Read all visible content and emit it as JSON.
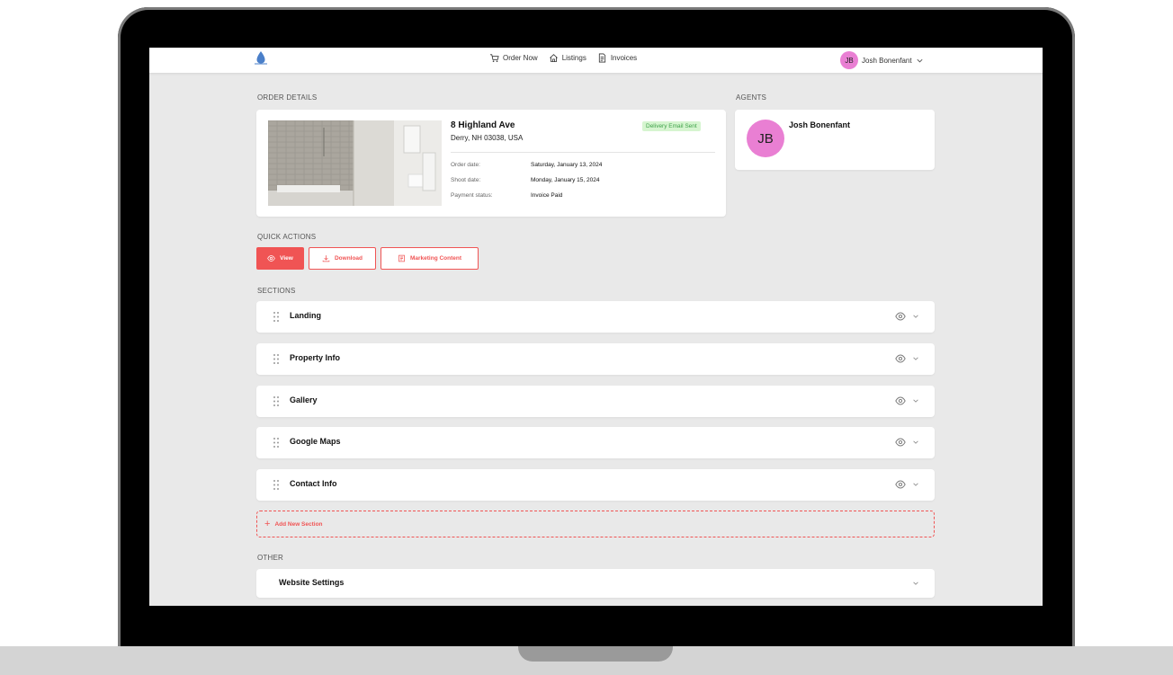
{
  "nav": {
    "logo_text": "",
    "links": [
      {
        "label": "Order Now",
        "icon": "cart-icon"
      },
      {
        "label": "Listings",
        "icon": "house-icon"
      },
      {
        "label": "Invoices",
        "icon": "document-icon"
      }
    ],
    "user": {
      "initials": "JB",
      "name": "Josh Bonenfant"
    }
  },
  "order_details": {
    "section_label": "ORDER DETAILS",
    "address_line1": "8 Highland Ave",
    "address_line2": "Derry, NH 03038, USA",
    "status_badge": "Delivery Email Sent",
    "fields": [
      {
        "key": "Order date:",
        "value": "Saturday, January 13, 2024"
      },
      {
        "key": "Shoot date:",
        "value": "Monday, January 15, 2024"
      },
      {
        "key": "Payment status:",
        "value": "Invoice Paid"
      }
    ]
  },
  "agents": {
    "section_label": "AGENTS",
    "initials": "JB",
    "name": "Josh Bonenfant"
  },
  "quick_actions": {
    "section_label": "QUICK ACTIONS",
    "view_label": "View",
    "download_label": "Download",
    "marketing_label": "Marketing Content"
  },
  "sections": {
    "section_label": "SECTIONS",
    "items": [
      "Landing",
      "Property Info",
      "Gallery",
      "Google Maps",
      "Contact Info"
    ],
    "add_label": "Add New Section"
  },
  "other": {
    "section_label": "OTHER",
    "settings_label": "Website Settings"
  },
  "colors": {
    "accent": "#f05454",
    "avatar": "#e97fd3",
    "badge_bg": "#d6f5d0",
    "badge_text": "#3fa24a",
    "page_bg": "#e9e9e9"
  }
}
